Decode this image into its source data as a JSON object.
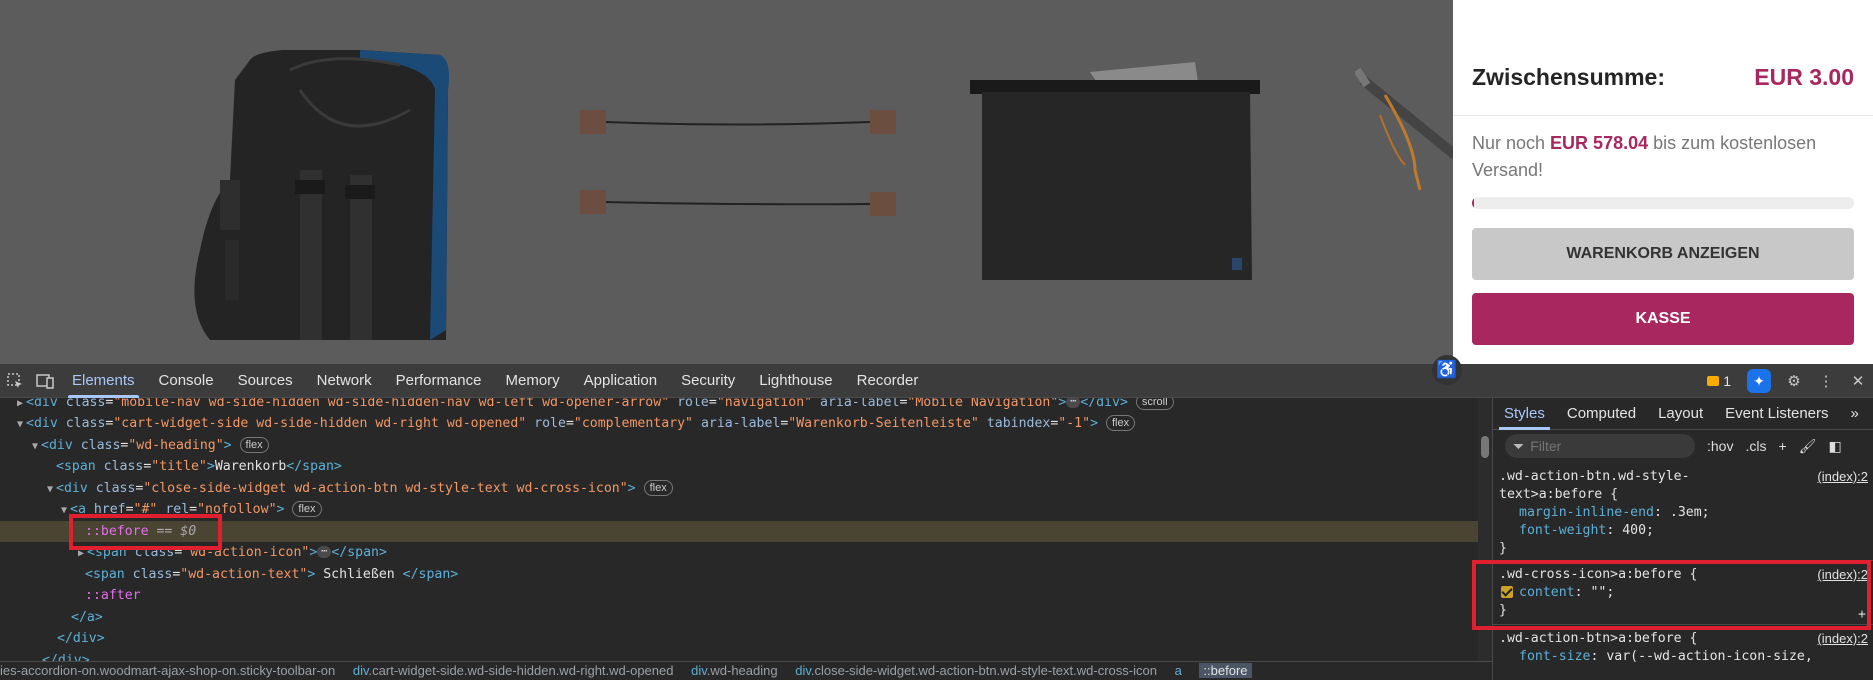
{
  "cart": {
    "subtotal_label": "Zwischensumme:",
    "subtotal_value": "EUR 3.00",
    "shipping_prefix": "Nur noch ",
    "shipping_amount": "EUR 578.04",
    "shipping_suffix": " bis zum kostenlosen Versand!",
    "shipping_progress_fraction": 0.005,
    "view_cart_label": "WARENKORB ANZEIGEN",
    "checkout_label": "KASSE",
    "accent_color": "#a8275e"
  },
  "devtools": {
    "tabs": [
      "Elements",
      "Console",
      "Sources",
      "Network",
      "Performance",
      "Memory",
      "Application",
      "Security",
      "Lighthouse",
      "Recorder"
    ],
    "issues_count": "1",
    "dom": {
      "line0": {
        "tag_open": "<div ",
        "a1": "class",
        "v1": "\"mobile-nav wd-side-hidden wd-side-hidden-nav wd-left wd-opener-arrow\"",
        "a2": "role",
        "v2": "\"navigation\"",
        "a3": "aria-label",
        "v3": "\"Mobile Navigation\"",
        "tag_close": "></div>",
        "chip": "scroll"
      },
      "line1": {
        "tag_open": "<div ",
        "a1": "class",
        "v1": "\"cart-widget-side wd-side-hidden wd-right wd-opened\"",
        "a2": "role",
        "v2": "\"complementary\"",
        "a3": "aria-label",
        "v3": "\"Warenkorb-Seitenleiste\"",
        "a4": "tabindex",
        "v4": "\"-1\"",
        "tag_close": ">",
        "chip": "flex"
      },
      "line2": {
        "tag_open": "<div ",
        "a1": "class",
        "v1": "\"wd-heading\"",
        "tag_close": ">",
        "chip": "flex"
      },
      "line3": {
        "tag_open": "<span ",
        "a1": "class",
        "v1": "\"title\"",
        "text": "Warenkorb",
        "tag_close": "</span>"
      },
      "line4": {
        "tag_open": "<div ",
        "a1": "class",
        "v1": "\"close-side-widget wd-action-btn wd-style-text wd-cross-icon\"",
        "tag_close": ">",
        "chip": "flex"
      },
      "line5": {
        "tag_open": "<a ",
        "a1": "href",
        "v1": "\"#\"",
        "a2": "rel",
        "v2": "\"nofollow\"",
        "tag_close": ">",
        "chip": "flex"
      },
      "line6": {
        "pseudo": "::before",
        "suffix": " == $0"
      },
      "line7": {
        "tag_open": "<span ",
        "a1": "class",
        "v1": "\"wd-action-icon\"",
        "tag_close": "></span>"
      },
      "line8": {
        "tag_open": "<span ",
        "a1": "class",
        "v1": "\"wd-action-text\"",
        "text": " Schließen ",
        "tag_close": "</span>"
      },
      "line9": {
        "pseudo": "::after"
      },
      "line10": {
        "tag": "</a>"
      },
      "line11": {
        "tag": "</div>"
      },
      "line12": {
        "tag": "</div>"
      }
    },
    "breadcrumb": [
      {
        "tag": "",
        "cls": "ies-accordion-on.woodmart-ajax-shop-on.sticky-toolbar-on"
      },
      {
        "tag": "div",
        "cls": ".cart-widget-side.wd-side-hidden.wd-right.wd-opened"
      },
      {
        "tag": "div",
        "cls": ".wd-heading"
      },
      {
        "tag": "div",
        "cls": ".close-side-widget.wd-action-btn.wd-style-text.wd-cross-icon"
      },
      {
        "tag": "a",
        "cls": ""
      },
      {
        "tag": "",
        "cls": "::before"
      }
    ],
    "styles": {
      "tabs": [
        "Styles",
        "Computed",
        "Layout",
        "Event Listeners"
      ],
      "filter_placeholder": "Filter",
      "hov": ":hov",
      "cls": ".cls",
      "rule1": {
        "selector_a": ".wd-action-btn.wd-style-",
        "selector_b": "text>a:before {",
        "source": "(index):2",
        "p1": "margin-inline-end",
        "v1": " .3em;",
        "p2": "font-weight",
        "v2": " 400;",
        "close": "}"
      },
      "rule2": {
        "selector": ".wd-cross-icon>a:before {",
        "source": "(index):2",
        "p1": "content",
        "v1": " \"\";",
        "close": "}"
      },
      "rule3": {
        "selector": ".wd-action-btn>a:before {",
        "source": "(index):2",
        "p1": "font-size",
        "v1": " var(--wd-action-icon-size,"
      }
    }
  }
}
